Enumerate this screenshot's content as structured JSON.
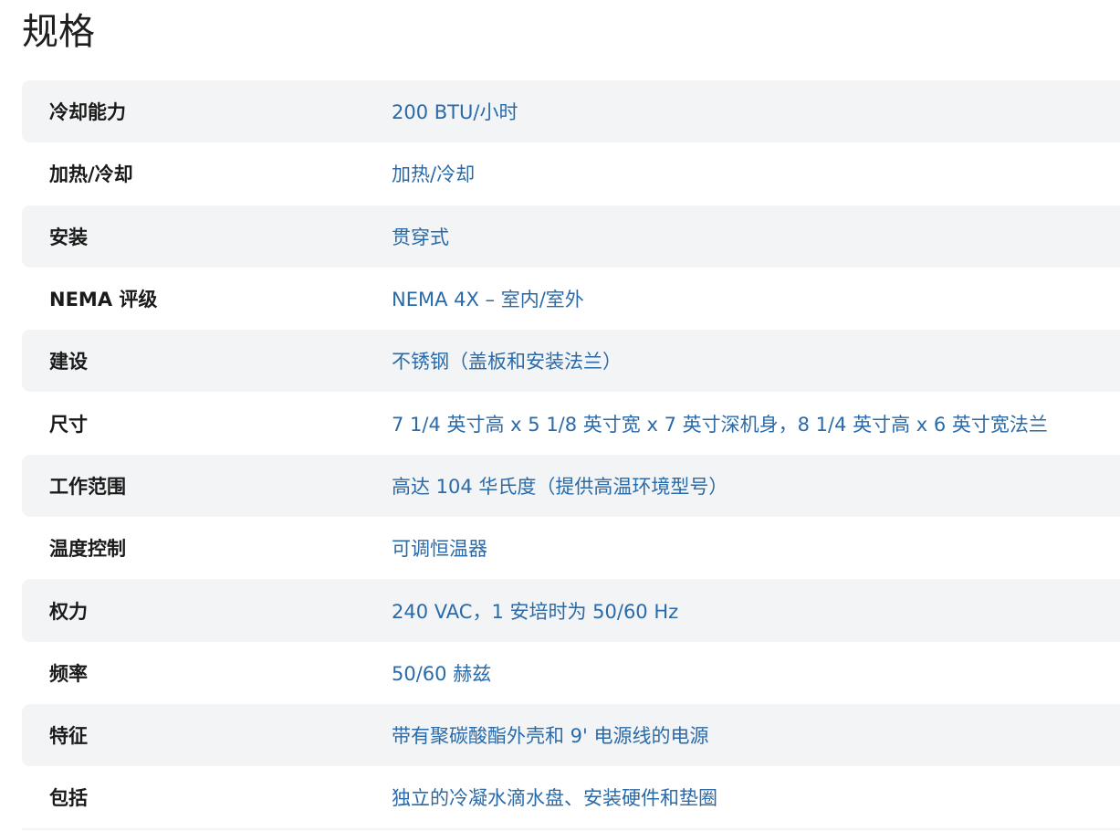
{
  "section": {
    "title": "规格"
  },
  "specs": [
    {
      "label": "冷却能力",
      "value": "200 BTU/小时"
    },
    {
      "label": "加热/冷却",
      "value": "加热/冷却"
    },
    {
      "label": "安装",
      "value": "贯穿式"
    },
    {
      "label": "NEMA 评级",
      "value": "NEMA 4X – 室内/室外"
    },
    {
      "label": "建设",
      "value": "不锈钢（盖板和安装法兰）"
    },
    {
      "label": "尺寸",
      "value": "7 1/4 英寸高 x 5 1/8 英寸宽 x 7 英寸深机身，8 1/4 英寸高 x 6 英寸宽法兰"
    },
    {
      "label": "工作范围",
      "value": "高达 104 华氏度（提供高温环境型号）"
    },
    {
      "label": "温度控制",
      "value": "可调恒温器"
    },
    {
      "label": "权力",
      "value": "240 VAC，1 安培时为 50/60 Hz"
    },
    {
      "label": "频率",
      "value": "50/60 赫兹"
    },
    {
      "label": "特征",
      "value": "带有聚碳酸酯外壳和 9' 电源线的电源"
    },
    {
      "label": "包括",
      "value": "独立的冷凝水滴水盘、安装硬件和垫圈"
    }
  ],
  "colors": {
    "label_text": "#1a1a1a",
    "value_text": "#2a6aa8",
    "row_stripe": "#f2f4f6"
  }
}
